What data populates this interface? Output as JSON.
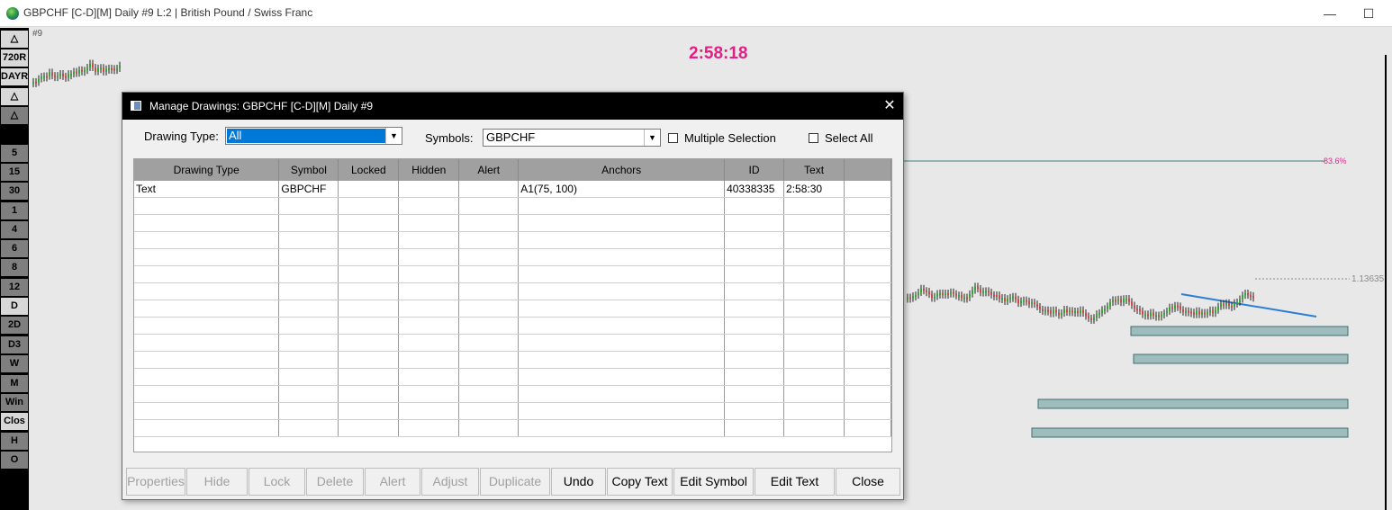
{
  "window": {
    "title": "GBPCHF [C-D][M]  Daily  #9 L:2 | British Pound / Swiss Franc",
    "minimize_glyph": "—",
    "maximize_glyph": "☐"
  },
  "toolbar": {
    "buttons": [
      {
        "label": "△",
        "style": "light"
      },
      {
        "label": "720R",
        "style": "light"
      },
      {
        "label": "DAYR",
        "style": "light"
      },
      {
        "label": "△",
        "style": "light"
      },
      {
        "label": "△",
        "style": "gray"
      },
      {
        "label": "",
        "style": "black"
      },
      {
        "label": "5",
        "style": "gray"
      },
      {
        "label": "15",
        "style": "gray"
      },
      {
        "label": "30",
        "style": "gray"
      },
      {
        "label": "1",
        "style": "gray"
      },
      {
        "label": "4",
        "style": "gray"
      },
      {
        "label": "6",
        "style": "gray"
      },
      {
        "label": "8",
        "style": "gray"
      },
      {
        "label": "12",
        "style": "gray"
      },
      {
        "label": "D",
        "style": "light"
      },
      {
        "label": "2D",
        "style": "gray"
      },
      {
        "label": "D3",
        "style": "gray"
      },
      {
        "label": "W",
        "style": "gray"
      },
      {
        "label": "M",
        "style": "gray"
      },
      {
        "label": "Win",
        "style": "gray"
      },
      {
        "label": "Clos",
        "style": "light"
      },
      {
        "label": "H",
        "style": "gray"
      },
      {
        "label": "O",
        "style": "gray"
      },
      {
        "label": "",
        "style": "black"
      }
    ]
  },
  "chart": {
    "chart_number": "#9",
    "timer_text": "2:58:18",
    "fib_level_label": "-83.6%",
    "price_label": "1.13635",
    "colors": {
      "up": "#2fa82f",
      "down": "#d64545",
      "trendline": "#2a7fd4",
      "zone": "#9fbcbc",
      "timer": "#e51e86"
    }
  },
  "dialog": {
    "title": "Manage Drawings: GBPCHF [C-D][M]  Daily  #9",
    "close_glyph": "✕",
    "drawing_type_label": "Drawing Type:",
    "drawing_type_value": "All",
    "symbols_label": "Symbols:",
    "symbols_value": "GBPCHF",
    "multiple_selection_label": "Multiple Selection",
    "select_all_label": "Select All",
    "columns": [
      "Drawing Type",
      "Symbol",
      "Locked",
      "Hidden",
      "Alert",
      "Anchors",
      "ID",
      "Text",
      ""
    ],
    "rows": [
      [
        "Text",
        "GBPCHF",
        "",
        "",
        "",
        "A1(75, 100)",
        "40338335",
        "2:58:30",
        ""
      ]
    ],
    "buttons": [
      {
        "label": "Properties",
        "enabled": false
      },
      {
        "label": "Hide",
        "enabled": false
      },
      {
        "label": "Lock",
        "enabled": false
      },
      {
        "label": "Delete",
        "enabled": false
      },
      {
        "label": "Alert",
        "enabled": false
      },
      {
        "label": "Adjust",
        "enabled": false
      },
      {
        "label": "Duplicate",
        "enabled": false
      },
      {
        "label": "Undo",
        "enabled": true
      },
      {
        "label": "Copy Text",
        "enabled": true
      },
      {
        "label": "Edit Symbol",
        "enabled": true
      },
      {
        "label": "Edit Text",
        "enabled": true
      },
      {
        "label": "Close",
        "enabled": true
      }
    ]
  }
}
